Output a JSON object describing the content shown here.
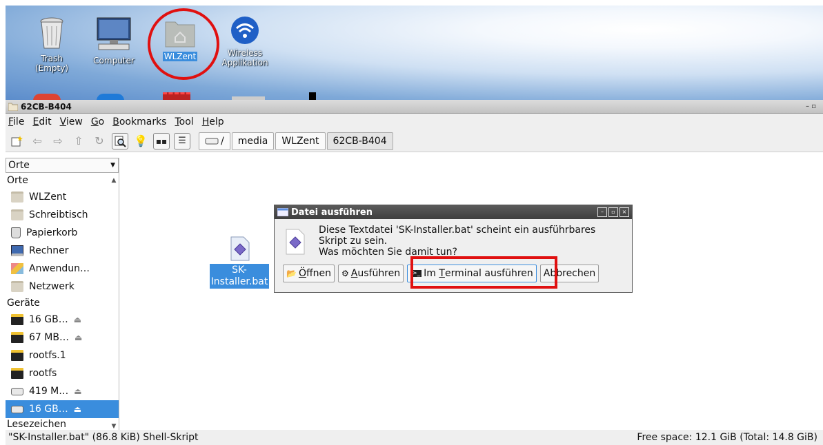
{
  "desktop": {
    "icons": [
      {
        "name": "trash",
        "label": "Trash\n(Empty)"
      },
      {
        "name": "computer",
        "label": "Computer"
      },
      {
        "name": "wlzent",
        "label": "WLZent"
      },
      {
        "name": "wireless",
        "label": "Wireless\nApplikation"
      }
    ]
  },
  "window": {
    "title": "62CB-B404",
    "controls": "– ▫"
  },
  "menu": {
    "items": [
      {
        "mn": "F",
        "rest": "ile"
      },
      {
        "mn": "E",
        "rest": "dit"
      },
      {
        "mn": "V",
        "rest": "iew"
      },
      {
        "mn": "G",
        "rest": "o"
      },
      {
        "mn": "B",
        "rest": "ookmarks"
      },
      {
        "mn": "T",
        "rest": "ool"
      },
      {
        "mn": "H",
        "rest": "elp"
      }
    ]
  },
  "path": {
    "root": "/",
    "segments": [
      "media",
      "WLZent",
      "62CB-B404"
    ]
  },
  "sidebar": {
    "select": "Orte",
    "section_places": "Orte",
    "places": [
      "WLZent",
      "Schreibtisch",
      "Papierkorb",
      "Rechner",
      "Anwendun…",
      "Netzwerk"
    ],
    "section_devices": "Geräte",
    "devices": [
      "16 GB…",
      "67 MB…",
      "rootfs.1",
      "rootfs",
      "419 M…",
      "16 GB…"
    ],
    "section_bookmarks": "Lesezeichen"
  },
  "file": {
    "label_line1": "SK-",
    "label_line2": "Installer.bat"
  },
  "dialog": {
    "title": "Datei ausführen",
    "line1": "Diese Textdatei 'SK-Installer.bat' scheint ein ausführbares",
    "line2": "Skript zu sein.",
    "line3": "Was möchten Sie damit tun?",
    "btn_open_mn": "Ö",
    "btn_open_rest": "ffnen",
    "btn_exec_mn": "A",
    "btn_exec_rest": "usführen",
    "btn_term_pre": "Im ",
    "btn_term_mn": "T",
    "btn_term_rest": "erminal ausführen",
    "btn_cancel": "Abbrechen"
  },
  "status": {
    "left": "\"SK-Installer.bat\" (86.8 KiB) Shell-Skript",
    "right": "Free space: 12.1 GiB (Total: 14.8 GiB)"
  },
  "colors": {
    "selection": "#3a8ddd",
    "annotation": "#e01010"
  }
}
